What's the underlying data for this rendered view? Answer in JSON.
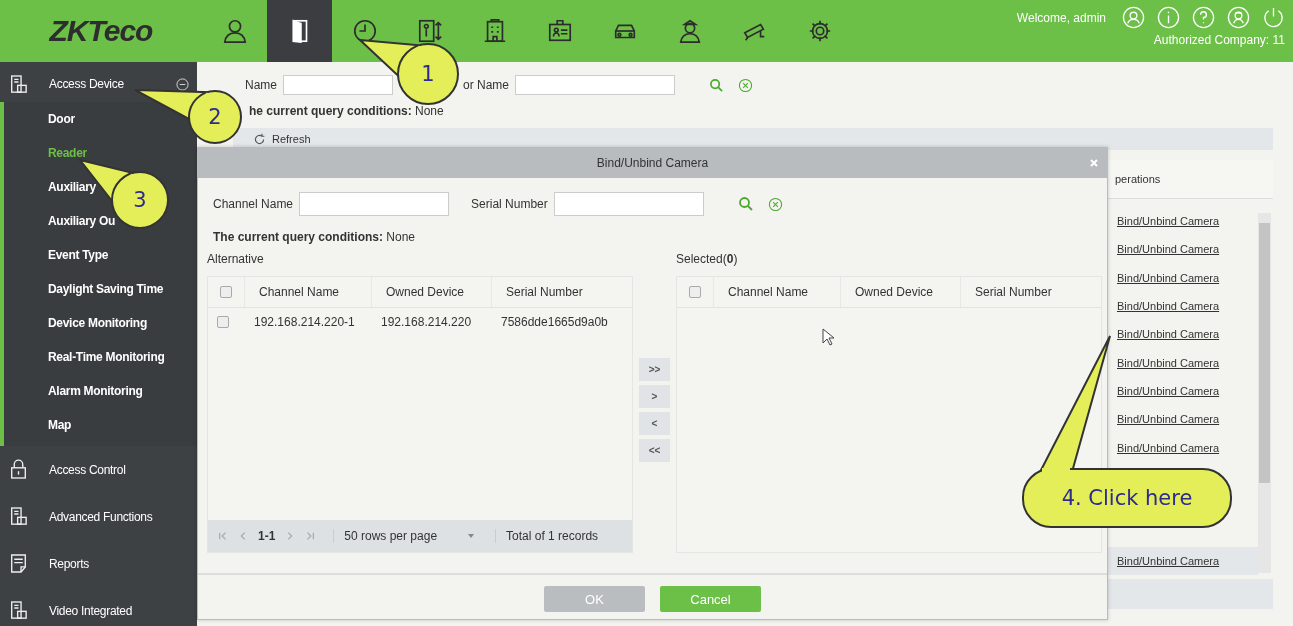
{
  "header": {
    "logo": "ZKTeco",
    "nav": [
      {
        "kind": "person",
        "selected": false
      },
      {
        "kind": "door",
        "selected": true
      },
      {
        "kind": "clock",
        "selected": false
      },
      {
        "kind": "elevator",
        "selected": false
      },
      {
        "kind": "building",
        "selected": false
      },
      {
        "kind": "badge",
        "selected": false
      },
      {
        "kind": "car",
        "selected": false
      },
      {
        "kind": "guard",
        "selected": false
      },
      {
        "kind": "camera",
        "selected": false
      },
      {
        "kind": "gear",
        "selected": false
      }
    ],
    "welcome": "Welcome, admin",
    "company": "Authorized Company: 11"
  },
  "sidebar": {
    "groups": [
      {
        "label": "Access Device",
        "kind": "device",
        "expanded": true,
        "items": [
          {
            "label": "Door",
            "selected": false
          },
          {
            "label": "Reader",
            "selected": true
          },
          {
            "label": "Auxiliary",
            "selected": false
          },
          {
            "label": "Auxiliary Ou",
            "selected": false
          },
          {
            "label": "Event Type",
            "selected": false
          },
          {
            "label": "Daylight Saving Time",
            "selected": false
          },
          {
            "label": "Device Monitoring",
            "selected": false
          },
          {
            "label": "Real-Time Monitoring",
            "selected": false
          },
          {
            "label": "Alarm Monitoring",
            "selected": false
          },
          {
            "label": "Map",
            "selected": false
          }
        ]
      },
      {
        "label": "Access Control",
        "kind": "lock",
        "expanded": false
      },
      {
        "label": "Advanced Functions",
        "kind": "device",
        "expanded": false
      },
      {
        "label": "Reports",
        "kind": "report",
        "expanded": false
      },
      {
        "label": "Video Integrated",
        "kind": "device",
        "expanded": false
      }
    ]
  },
  "filter": {
    "fields": [
      {
        "label": "Name"
      },
      {
        "label": "or Name"
      }
    ]
  },
  "query": "**he current query conditions:** None",
  "toolbar": {
    "refresh": "Refresh"
  },
  "background_table": {
    "column": "perations",
    "rows": [
      {
        "operation": "Bind/Unbind Camera",
        "highlighted": false
      },
      {
        "operation": "Bind/Unbind Camera",
        "highlighted": false
      },
      {
        "operation": "Bind/Unbind Camera",
        "highlighted": false
      },
      {
        "operation": "Bind/Unbind Camera",
        "highlighted": false
      },
      {
        "operation": "Bind/Unbind Camera",
        "highlighted": false
      },
      {
        "operation": "Bind/Unbind Camera",
        "highlighted": false
      },
      {
        "operation": "Bind/Unbind Camera",
        "highlighted": false
      },
      {
        "operation": "Bind/Unbind Camera",
        "highlighted": false
      },
      {
        "operation": "Bind/Unbind Camera",
        "highlighted": false
      },
      {
        "operation": "Bind/Unbind Camera",
        "highlighted": true
      }
    ]
  },
  "dialog": {
    "title": "Bind/Unbind Camera",
    "fields": [
      {
        "label": "Channel Name"
      },
      {
        "label": "Serial Number"
      }
    ],
    "query": "**The current query conditions:** None",
    "alternative": {
      "title": "Alternative",
      "header_checked": false,
      "columns": [
        "Channel Name",
        "Owned Device",
        "Serial Number"
      ],
      "rows": [
        {
          "checked": false,
          "cells": [
            "192.168.214.220-1",
            "192.168.214.220",
            "7586dde1665d9a0b"
          ]
        }
      ],
      "pager": {
        "range": "1-1",
        "page_size": "50 rows per page",
        "total": "Total of 1 records"
      }
    },
    "transfer": [
      ">>",
      ">",
      "<",
      "<<"
    ],
    "selected": {
      "title": "Selected(**0**)",
      "header_checked": false,
      "columns": [
        "Channel Name",
        "Owned Device",
        "Serial Number"
      ]
    },
    "buttons": [
      {
        "label": "OK",
        "kind": "secondary"
      },
      {
        "label": "Cancel",
        "kind": "primary"
      }
    ]
  },
  "callouts": [
    {
      "label": "1",
      "kind": "circle"
    },
    {
      "label": "2",
      "kind": "circle"
    },
    {
      "label": "3",
      "kind": "circle"
    },
    {
      "label": "4. Click here",
      "kind": "pill"
    }
  ]
}
